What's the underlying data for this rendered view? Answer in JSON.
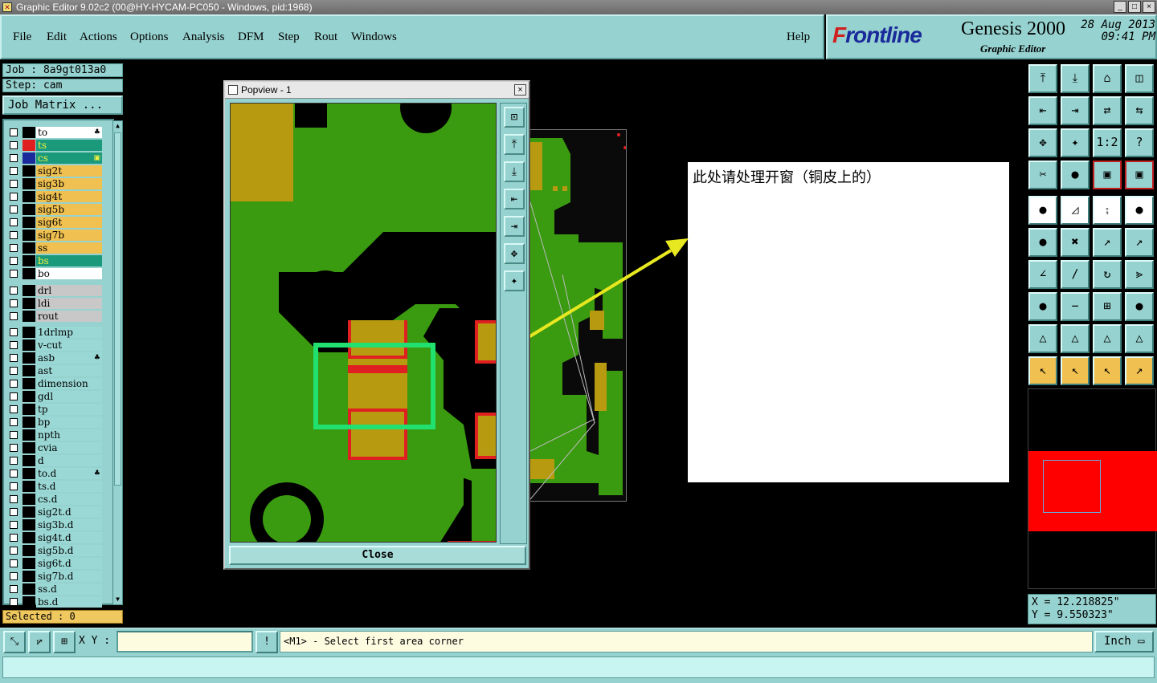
{
  "window": {
    "title": "Graphic Editor 9.02c2 (00@HY-HYCAM-PC050 - Windows, pid:1968)",
    "btn_min": "_",
    "btn_max": "□",
    "btn_close": "×"
  },
  "menu": {
    "file": "File",
    "edit": "Edit",
    "actions": "Actions",
    "options": "Options",
    "analysis": "Analysis",
    "dfm": "DFM",
    "step": "Step",
    "rout": "Rout",
    "windows": "Windows",
    "help": "Help"
  },
  "logo": {
    "brand_f": "F",
    "brand_rest": "rontline",
    "product": "Genesis 2000",
    "subtitle": "Graphic Editor",
    "date": "28 Aug 2013",
    "time": "09:41 PM"
  },
  "job": {
    "job_line": "Job : 8a9gt013a0",
    "step_line": "Step: cam",
    "matrix_button": "Job Matrix ..."
  },
  "layers": [
    {
      "name": "to",
      "color": "#ffffff",
      "swatch": "#000000",
      "mark": "♣"
    },
    {
      "name": "ts",
      "color": "#1a9a7a",
      "swatch": "#e02020",
      "mark": ""
    },
    {
      "name": "cs",
      "color": "#1a9a7a",
      "swatch": "#2a9a2a",
      "mark": "▣",
      "active": true
    },
    {
      "name": "sig2t",
      "color": "#f0c050",
      "swatch": "#000000",
      "mark": ""
    },
    {
      "name": "sig3b",
      "color": "#f0c050",
      "swatch": "#000000",
      "mark": ""
    },
    {
      "name": "sig4t",
      "color": "#f0c050",
      "swatch": "#000000",
      "mark": ""
    },
    {
      "name": "sig5b",
      "color": "#f0c050",
      "swatch": "#000000",
      "mark": ""
    },
    {
      "name": "sig6t",
      "color": "#f0c050",
      "swatch": "#000000",
      "mark": ""
    },
    {
      "name": "sig7b",
      "color": "#f0c050",
      "swatch": "#000000",
      "mark": ""
    },
    {
      "name": "ss",
      "color": "#f0c050",
      "swatch": "#000000",
      "mark": ""
    },
    {
      "name": "bs",
      "color": "#1a9a7a",
      "swatch": "#000000",
      "mark": ""
    },
    {
      "name": "bo",
      "color": "#ffffff",
      "swatch": "#000000",
      "mark": ""
    }
  ],
  "drill_layers": [
    {
      "name": "drl",
      "color": "#c8c8c8",
      "swatch": "#000000",
      "mark": ""
    },
    {
      "name": "ldi",
      "color": "#c8c8c8",
      "swatch": "#000000",
      "mark": ""
    },
    {
      "name": "rout",
      "color": "#c8c8c8",
      "swatch": "#000000",
      "mark": ""
    }
  ],
  "misc_layers": [
    {
      "name": "1drlmp",
      "color": "#9ad8d5",
      "swatch": "#000000",
      "mark": ""
    },
    {
      "name": "v-cut",
      "color": "#9ad8d5",
      "swatch": "#000000",
      "mark": ""
    },
    {
      "name": "asb",
      "color": "#9ad8d5",
      "swatch": "#000000",
      "mark": "♣"
    },
    {
      "name": "ast",
      "color": "#9ad8d5",
      "swatch": "#000000",
      "mark": ""
    },
    {
      "name": "dimension",
      "color": "#9ad8d5",
      "swatch": "#000000",
      "mark": ""
    },
    {
      "name": "gdl",
      "color": "#9ad8d5",
      "swatch": "#000000",
      "mark": ""
    },
    {
      "name": "tp",
      "color": "#9ad8d5",
      "swatch": "#000000",
      "mark": ""
    },
    {
      "name": "bp",
      "color": "#9ad8d5",
      "swatch": "#000000",
      "mark": ""
    },
    {
      "name": "npth",
      "color": "#9ad8d5",
      "swatch": "#000000",
      "mark": ""
    },
    {
      "name": "cvia",
      "color": "#9ad8d5",
      "swatch": "#000000",
      "mark": ""
    },
    {
      "name": "d",
      "color": "#9ad8d5",
      "swatch": "#000000",
      "mark": ""
    },
    {
      "name": "to.d",
      "color": "#9ad8d5",
      "swatch": "#000000",
      "mark": "♣"
    },
    {
      "name": "ts.d",
      "color": "#9ad8d5",
      "swatch": "#000000",
      "mark": ""
    },
    {
      "name": "cs.d",
      "color": "#9ad8d5",
      "swatch": "#000000",
      "mark": ""
    },
    {
      "name": "sig2t.d",
      "color": "#9ad8d5",
      "swatch": "#000000",
      "mark": ""
    },
    {
      "name": "sig3b.d",
      "color": "#9ad8d5",
      "swatch": "#000000",
      "mark": ""
    },
    {
      "name": "sig4t.d",
      "color": "#9ad8d5",
      "swatch": "#000000",
      "mark": ""
    },
    {
      "name": "sig5b.d",
      "color": "#9ad8d5",
      "swatch": "#000000",
      "mark": ""
    },
    {
      "name": "sig6t.d",
      "color": "#9ad8d5",
      "swatch": "#000000",
      "mark": ""
    },
    {
      "name": "sig7b.d",
      "color": "#9ad8d5",
      "swatch": "#000000",
      "mark": ""
    },
    {
      "name": "ss.d",
      "color": "#9ad8d5",
      "swatch": "#000000",
      "mark": ""
    },
    {
      "name": "bs.d",
      "color": "#9ad8d5",
      "swatch": "#000000",
      "mark": ""
    }
  ],
  "selected": "Selected : 0",
  "popview": {
    "title": "Popview - 1",
    "close_label": "Close",
    "close_x": "×"
  },
  "note": {
    "text": "此处请处理开窗（铜皮上的）"
  },
  "toolbar_glyphs": [
    "⤒",
    "⤓",
    "⌂",
    "◫",
    "⇤",
    "⇥",
    "⇄",
    "⇆",
    "✥",
    "✦",
    "1:2",
    "?",
    "✂",
    "●",
    "▣",
    "▣",
    "●",
    "◿",
    "⨟",
    "●",
    "●",
    "✖",
    "↗",
    "↗",
    "∠",
    "∕",
    "↻",
    "⪢",
    "●",
    "−",
    "⊞",
    "●",
    "△",
    "△",
    "△",
    "△",
    "↖",
    "↖",
    "↖",
    "↗"
  ],
  "coords": {
    "x": "X = 12.218825\"",
    "y": "Y = 9.550323\""
  },
  "bottom": {
    "xy_label": "X Y :",
    "xy_value": "",
    "msg_icon": "!",
    "message": "<M1> - Select first area corner",
    "unit": "Inch"
  },
  "colors": {
    "panel": "#96d2cf",
    "copper": "#3a9a10",
    "pad": "#b89a10",
    "highlight": "#20e070",
    "arrow": "#e8e820"
  }
}
